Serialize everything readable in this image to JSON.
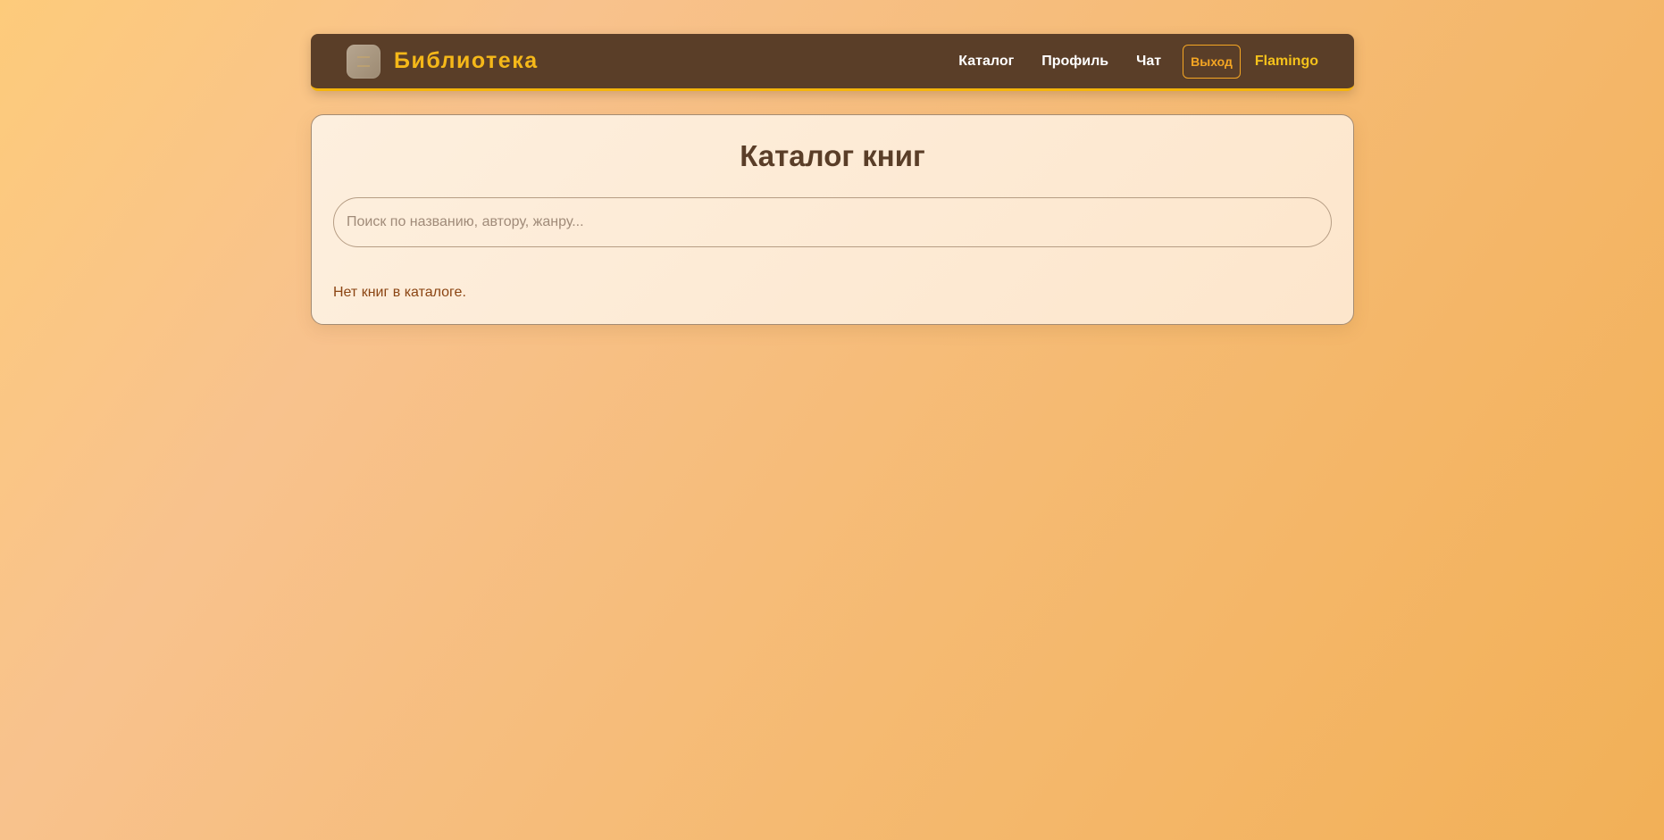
{
  "header": {
    "brand_title": "Библиотека",
    "nav": {
      "catalog": "Каталог",
      "profile": "Профиль",
      "chat": "Чат",
      "logout": "Выход",
      "username": "Flamingo"
    }
  },
  "main": {
    "title": "Каталог книг",
    "search": {
      "placeholder": "Поиск по названию, автору, жанру...",
      "value": ""
    },
    "empty_message": "Нет книг в каталоге."
  },
  "colors": {
    "navbar_bg": "#5a3e28",
    "accent": "#f5b819",
    "logout": "#f5a623",
    "empty_text": "#8b4513"
  }
}
